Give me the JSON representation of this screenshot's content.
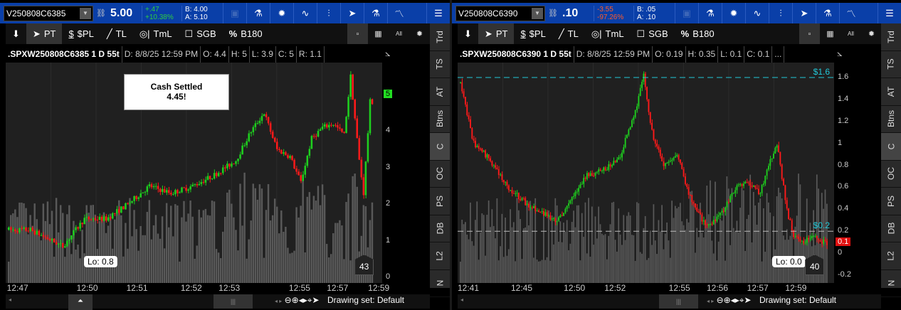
{
  "panels": [
    {
      "symbol": "V250808C6385",
      "last": "5.00",
      "change": "+.47",
      "change_pct": "+10.38%",
      "change_color": "#2ecc40",
      "bid": "B: 4.00",
      "ask": "A: 5.10",
      "header": {
        "title": ".SPXW250808C6385 1 D 55t",
        "date": "D: 8/8/25 12:59 PM",
        "o": "O: 4.4",
        "h": "H: 5",
        "l": "L: 3.9",
        "c": "C: 5",
        "r": "R: 1.1"
      },
      "y_ticks": [
        "0",
        "1",
        "2",
        "3",
        "4",
        "5"
      ],
      "y_range": [
        0,
        5
      ],
      "times": [
        "12:47",
        "12:50",
        "12:51",
        "12:52",
        "12:53",
        "12:55",
        "12:57",
        "12:59"
      ],
      "price_tag": "5",
      "price_tag_value": 5,
      "lo_label": "Lo: 0.8",
      "volume_label": "43",
      "annotation": {
        "line1": "Cash Settled",
        "line2": "4.45!"
      },
      "path": [
        [
          0,
          1.3
        ],
        [
          10,
          1.3
        ],
        [
          20,
          1.0
        ],
        [
          25,
          0.85
        ],
        [
          35,
          1.6
        ],
        [
          45,
          1.6
        ],
        [
          55,
          2.0
        ],
        [
          65,
          2.5
        ],
        [
          75,
          2.3
        ],
        [
          85,
          2.5
        ],
        [
          95,
          2.8
        ],
        [
          105,
          3.2
        ],
        [
          112,
          4.0
        ],
        [
          118,
          4.5
        ],
        [
          124,
          3.5
        ],
        [
          130,
          3.3
        ],
        [
          135,
          2.6
        ],
        [
          140,
          3.8
        ],
        [
          145,
          4.1
        ],
        [
          150,
          4.2
        ],
        [
          155,
          3.9
        ],
        [
          158,
          5.5
        ],
        [
          162,
          3.2
        ],
        [
          164,
          2.3
        ],
        [
          167,
          4.8
        ]
      ],
      "hlines": []
    },
    {
      "symbol": "V250808C6390",
      "last": ".10",
      "change": "-3.55",
      "change_pct": "-97.26%",
      "change_color": "#ff5a2a",
      "bid": "B: .05",
      "ask": "A: .10",
      "header": {
        "title": ".SPXW250808C6390 1 D 55t",
        "date": "D: 8/8/25 12:59 PM",
        "o": "O: 0.19",
        "h": "H: 0.35",
        "l": "L: 0.1",
        "c": "C: 0.1",
        "r": "..."
      },
      "y_ticks": [
        "-0.2",
        "0",
        "0.2",
        "0.4",
        "0.6",
        "0.8",
        "1",
        "1.2",
        "1.4",
        "1.6"
      ],
      "y_range": [
        -0.2,
        1.6
      ],
      "times": [
        "12:41",
        "12:45",
        "12:50",
        "12:52",
        "12:55",
        "12:56",
        "12:57",
        "12:59"
      ],
      "price_tag": "0.1",
      "price_tag_value": 0.1,
      "lo_label": "Lo: 0.0",
      "volume_label": "40",
      "hlines": [
        {
          "label": "$1.6",
          "value": 1.6
        },
        {
          "label": "$0.2",
          "value": 0.2
        }
      ],
      "path": [
        [
          0,
          1.55
        ],
        [
          8,
          1.0
        ],
        [
          18,
          0.85
        ],
        [
          28,
          0.6
        ],
        [
          40,
          0.45
        ],
        [
          52,
          0.35
        ],
        [
          58,
          0.28
        ],
        [
          65,
          0.45
        ],
        [
          75,
          0.7
        ],
        [
          85,
          0.75
        ],
        [
          95,
          0.85
        ],
        [
          105,
          1.3
        ],
        [
          110,
          1.62
        ],
        [
          115,
          1.1
        ],
        [
          122,
          0.8
        ],
        [
          130,
          0.9
        ],
        [
          137,
          0.55
        ],
        [
          145,
          0.3
        ],
        [
          150,
          0.25
        ],
        [
          158,
          0.4
        ],
        [
          166,
          0.6
        ],
        [
          172,
          0.65
        ],
        [
          180,
          0.55
        ],
        [
          186,
          0.85
        ],
        [
          190,
          1.0
        ],
        [
          196,
          0.4
        ],
        [
          200,
          0.15
        ],
        [
          206,
          0.1
        ],
        [
          212,
          0.15
        ],
        [
          216,
          0.1
        ]
      ]
    }
  ],
  "tools": {
    "pt": "PT",
    "pl": "$PL",
    "tl": "TL",
    "tml": "TmL",
    "sgb": "SGB",
    "b180": "B180",
    "pct": "%"
  },
  "side_tabs": [
    "Trd",
    "TS",
    "AT",
    "Btns",
    "C",
    "OC",
    "PS",
    "DB",
    "L2",
    "N"
  ],
  "drawing_set": "Drawing set: Default"
}
